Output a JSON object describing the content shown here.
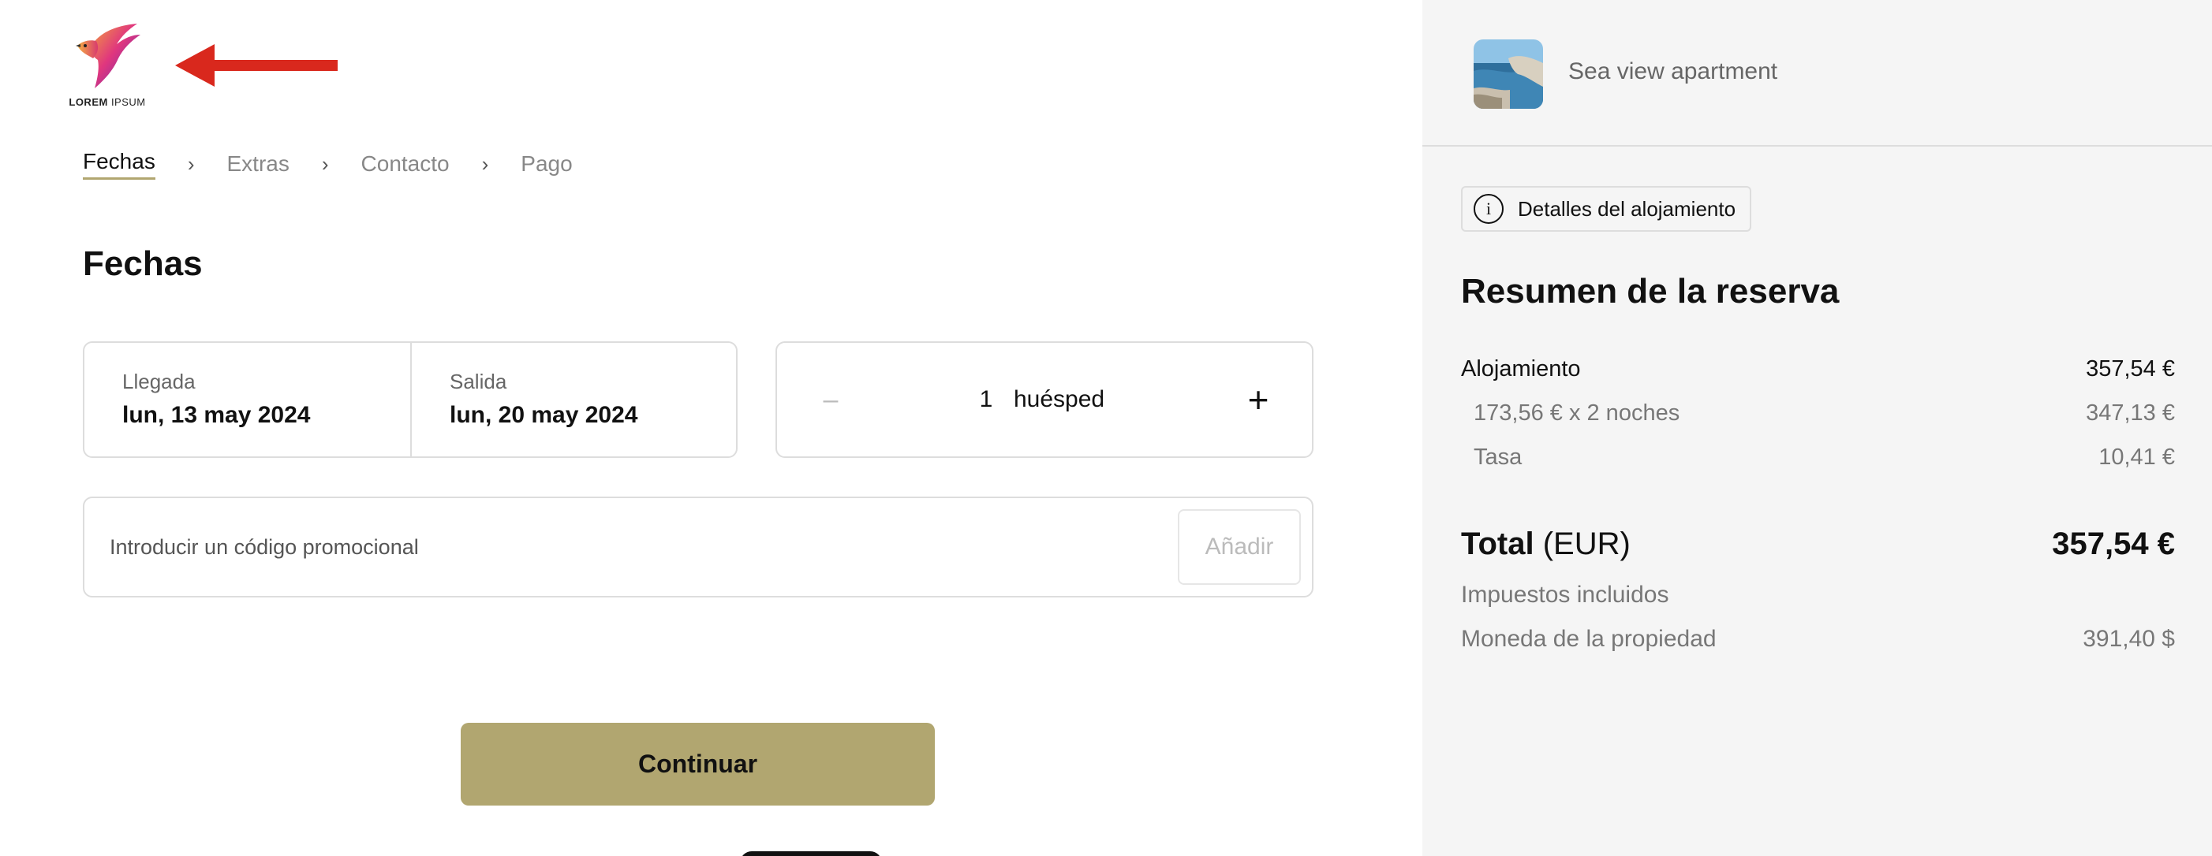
{
  "brand": {
    "logo_text_bold": "LOREM",
    "logo_text_light": " IPSUM",
    "logo_icon": "bird-logo-icon",
    "arrow_icon": "red-arrow-left-icon",
    "arrow_color": "#d9281d"
  },
  "steps": [
    {
      "label": "Fechas",
      "active": true
    },
    {
      "label": "Extras",
      "active": false
    },
    {
      "label": "Contacto",
      "active": false
    },
    {
      "label": "Pago",
      "active": false
    }
  ],
  "step_separator": "›",
  "page_title": "Fechas",
  "dates": {
    "arrival_label": "Llegada",
    "arrival_value": "lun, 13 may 2024",
    "departure_label": "Salida",
    "departure_value": "lun, 20 may 2024"
  },
  "guests": {
    "minus": "–",
    "count": "1",
    "unit": "huésped",
    "plus": "+"
  },
  "promo": {
    "placeholder": "Introducir un código promocional",
    "button": "Añadir"
  },
  "continue_label": "Continuar",
  "summary": {
    "property_name": "Sea view apartment",
    "details_label": "Detalles del alojamiento",
    "info_icon": "i",
    "title": "Resumen de la reserva",
    "accommodation_label": "Alojamiento",
    "accommodation_value": "357,54 €",
    "nights_label": "173,56 € x 2 noches",
    "nights_value": "347,13 €",
    "tax_label": "Tasa",
    "tax_value": "10,41 €",
    "total_label_bold": "Total",
    "total_label_currency": " (EUR)",
    "total_value": "357,54 €",
    "taxes_included": "Impuestos incluidos",
    "property_currency_label": "Moneda de la propiedad",
    "property_currency_value": "391,40 $"
  },
  "colors": {
    "accent": "#b1a670",
    "sidebar_bg": "#f5f5f5",
    "border": "#dddddd"
  }
}
